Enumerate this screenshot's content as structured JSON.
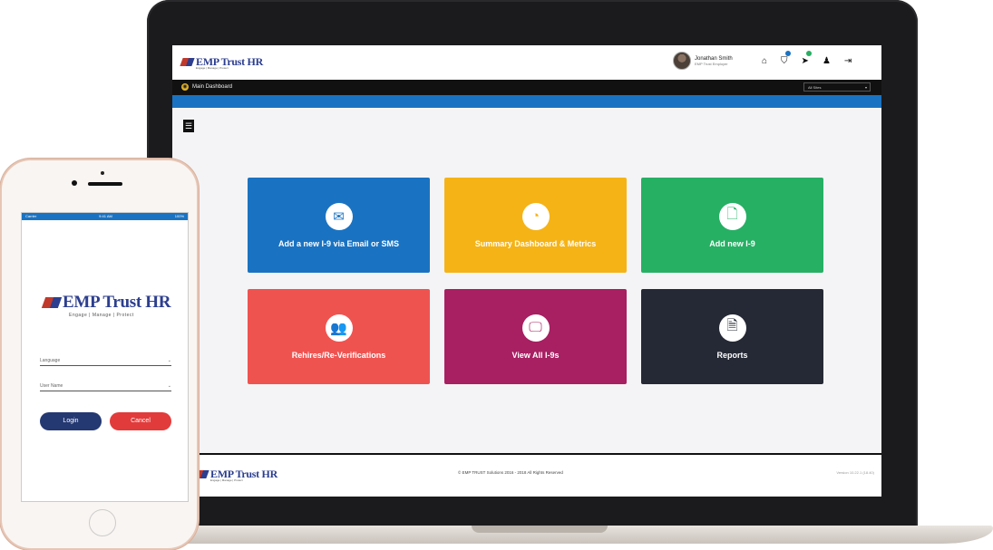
{
  "app": {
    "brand_logo": "EMP Trust HR",
    "brand_tagline": "Engage | Manage | Protect"
  },
  "header": {
    "user_name": "Jonathan Smith",
    "user_role": "EMP Trust Employer",
    "icons": [
      "home-icon",
      "cart-icon",
      "tag-icon",
      "user-icon",
      "logout-icon"
    ],
    "badge_colors": {
      "cart": "#1a73c2",
      "tag": "#27ae60"
    }
  },
  "nav": {
    "dashboard_label": "Main Dashboard",
    "select_value": "All Sites"
  },
  "tiles": [
    {
      "label": "Add a new I-9 via Email or SMS",
      "icon": "email-icon",
      "color": "#1a73c2",
      "glyph": "✉"
    },
    {
      "label": "Summary Dashboard & Metrics",
      "icon": "dashboard-icon",
      "color": "#f5b316",
      "glyph": "◔"
    },
    {
      "label": "Add new I-9",
      "icon": "document-icon",
      "color": "#26b064",
      "glyph": "🗋"
    },
    {
      "label": "Rehires/Re-Verifications",
      "icon": "users-icon",
      "color": "#ef5350",
      "glyph": "👥"
    },
    {
      "label": "View All I-9s",
      "icon": "monitor-icon",
      "color": "#a81f62",
      "glyph": "🖵"
    },
    {
      "label": "Reports",
      "icon": "report-icon",
      "color": "#252935",
      "glyph": "🗎"
    }
  ],
  "footer": {
    "copyright": "© EMP TRUST Solutions 2016 - 2018 All Rights Reserved",
    "version": "Version 10.22.1 (18.40)"
  },
  "phone": {
    "status_left": "Carrier",
    "status_time": "9:41 AM",
    "status_right": "100%",
    "field_language": "Language",
    "field_user": "User Name",
    "login_label": "Login",
    "cancel_label": "Cancel",
    "login_color": "#243872",
    "cancel_color": "#e23b3b"
  }
}
